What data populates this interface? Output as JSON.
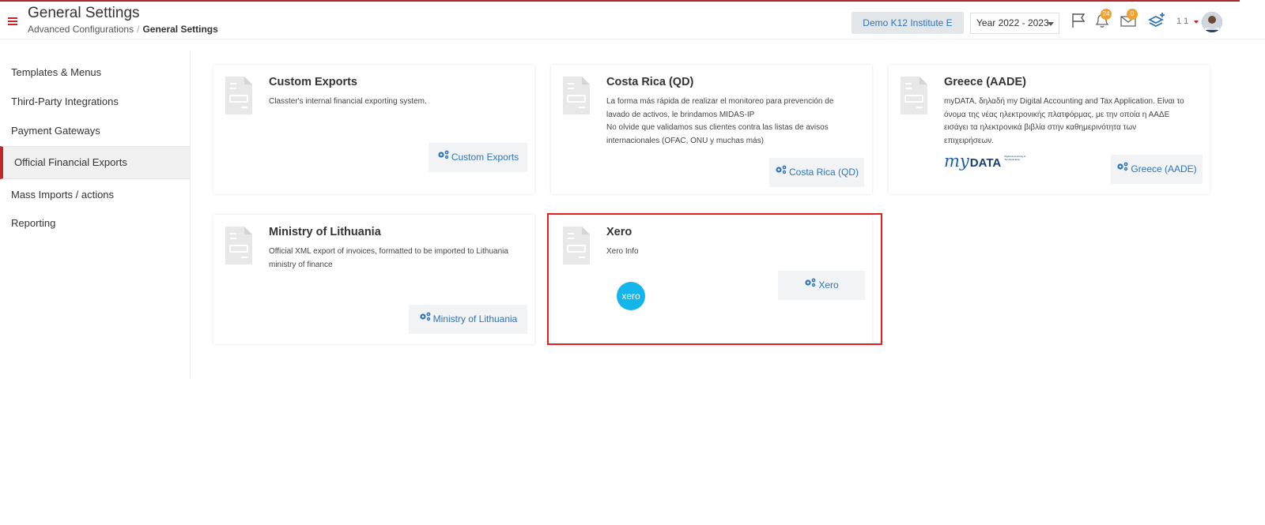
{
  "header": {
    "title": "General Settings",
    "breadcrumb": {
      "parent": "Advanced Configurations",
      "separator": "/",
      "current": "General Settings"
    },
    "school": "Demo K12 Institute E",
    "year": "Year 2022 - 2023",
    "notifications_count": "24",
    "messages_count": "0",
    "user_count": "1 1"
  },
  "sidebar": {
    "items": [
      {
        "label": "Templates & Menus"
      },
      {
        "label": "Third-Party Integrations"
      },
      {
        "label": "Payment Gateways"
      },
      {
        "label": "Official Financial Exports"
      },
      {
        "label": "Mass Imports / actions"
      },
      {
        "label": "Reporting"
      }
    ]
  },
  "cards": [
    {
      "title": "Custom Exports",
      "description": [
        "Classter's internal financial exporting system."
      ],
      "button": "Custom Exports"
    },
    {
      "title": "Costa Rica (QD)",
      "description": [
        "La forma más rápida de realizar el monitoreo para prevención de",
        "lavado de activos, le brindamos MIDAS-IP",
        "No olvide que validamos sus clientes contra las listas de avisos",
        "internacionales (OFAC, ONU y muchas más)"
      ],
      "button": "Costa Rica (QD)"
    },
    {
      "title": "Greece (AADE)",
      "description": [
        "myDATA, δηλαδή my Digital Accounting and Tax Application. Είναι το",
        "όνομα της νέας ηλεκτρονικής πλατφόρμας, με την οποία η ΑΑΔΕ",
        "εισάγει τα ηλεκτρονικά βιβλία στην καθημερινότητα των",
        "επιχειρήσεων."
      ],
      "button": "Greece (AADE)",
      "logo": {
        "my": "my",
        "data": "DATA",
        "tagline": "Digital Accounting & Tax Application"
      }
    },
    {
      "title": "Ministry of Lithuania",
      "description": [
        "Official XML export of invoices, formatted to be imported to Lithuania",
        "ministry of finance"
      ],
      "button": "Ministry of Lithuania"
    },
    {
      "title": "Xero",
      "description": [
        "Xero Info"
      ],
      "button": "Xero",
      "logo": {
        "text": "xero"
      }
    }
  ],
  "colors": {
    "accent": "#c0272d",
    "link": "#2f74b8",
    "xero": "#13b5ea",
    "highlight": "#e02020"
  }
}
